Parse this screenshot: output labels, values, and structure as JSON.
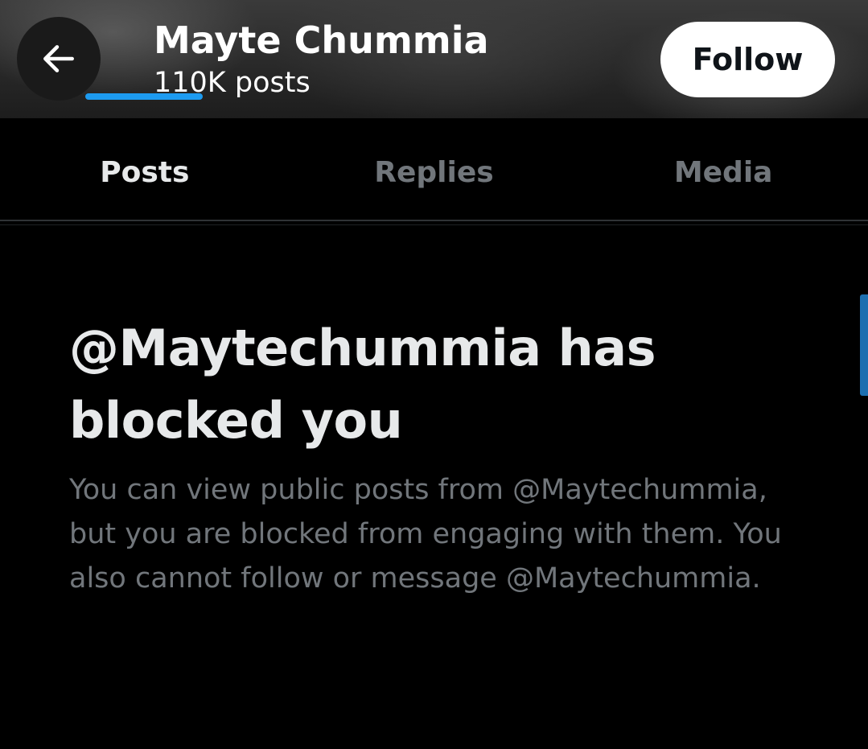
{
  "header": {
    "name": "Mayte Chummia",
    "post_count": "110K posts",
    "follow_label": "Follow"
  },
  "tabs": [
    {
      "label": "Posts",
      "active": true
    },
    {
      "label": "Replies",
      "active": false
    },
    {
      "label": "Media",
      "active": false
    }
  ],
  "blocked": {
    "title": "@Maytechummia has blocked you",
    "body": "You can view public posts from @Maytechummia, but you are blocked from engaging with them. You also cannot follow or message @Maytechummia."
  },
  "colors": {
    "accent": "#1d9bf0",
    "text_primary": "#e7e9ea",
    "text_secondary": "#71767b",
    "background": "#000000"
  },
  "icons": {
    "back": "arrow-left-icon"
  }
}
